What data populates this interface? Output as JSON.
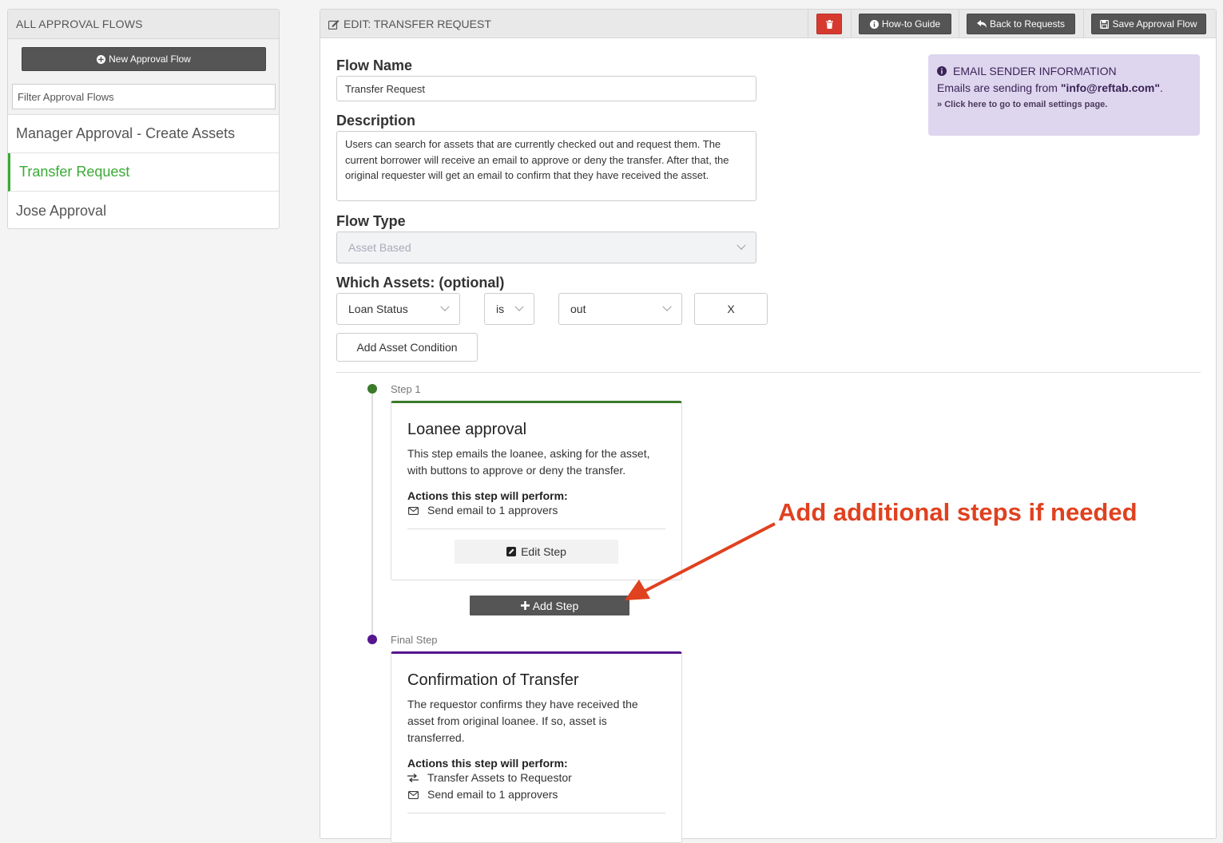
{
  "sidebar": {
    "title": "ALL APPROVAL FLOWS",
    "new_flow_label": "New Approval Flow",
    "filter_placeholder": "Filter Approval Flows",
    "items": [
      {
        "label": "Manager Approval - Create Assets",
        "active": false
      },
      {
        "label": "Transfer Request",
        "active": true
      },
      {
        "label": "Jose Approval",
        "active": false
      }
    ]
  },
  "header": {
    "title": "EDIT: TRANSFER REQUEST",
    "howto_label": "How-to Guide",
    "back_label": "Back to Requests",
    "save_label": "Save Approval Flow"
  },
  "form": {
    "flow_name_label": "Flow Name",
    "flow_name_value": "Transfer Request",
    "description_label": "Description",
    "description_value": "Users can search for assets that are currently checked out and request them. The current borrower will receive an email to approve or deny the transfer. After that, the original requester will get an email to confirm that they have received the asset.",
    "flow_type_label": "Flow Type",
    "flow_type_value": "Asset Based",
    "which_assets_label": "Which Assets: (optional)",
    "condition": {
      "field": "Loan Status",
      "operator": "is",
      "value": "out",
      "remove_label": "X"
    },
    "add_condition_label": "Add Asset Condition"
  },
  "info": {
    "title": "EMAIL SENDER INFORMATION",
    "line_prefix": "Emails are sending from ",
    "email": "\"info@reftab.com\"",
    "line_suffix": ".",
    "link": "Click here to go to email settings page."
  },
  "steps": [
    {
      "label": "Step 1",
      "title": "Loanee approval",
      "description": "This step emails the loanee, asking for the asset, with buttons to approve or deny the transfer.",
      "actions_heading": "Actions this step will perform:",
      "actions": [
        {
          "icon": "envelope-icon",
          "text": "Send email to 1 approvers"
        }
      ],
      "edit_label": "Edit Step",
      "color": "#3a7a2a"
    },
    {
      "label": "Final Step",
      "title": "Confirmation of Transfer",
      "description": "The requestor confirms they have received the asset from original loanee. If so, asset is transferred.",
      "actions_heading": "Actions this step will perform:",
      "actions": [
        {
          "icon": "transfer-icon",
          "text": "Transfer Assets to Requestor"
        },
        {
          "icon": "envelope-icon",
          "text": "Send email to 1 approvers"
        }
      ],
      "color": "#55168e"
    }
  ],
  "add_step_label": "Add Step",
  "annotation": "Add additional steps if needed",
  "colors": {
    "active": "#3aaa35",
    "danger": "#d63a2f",
    "annotation": "#e0411f",
    "info_bg": "#ddd6ee"
  }
}
